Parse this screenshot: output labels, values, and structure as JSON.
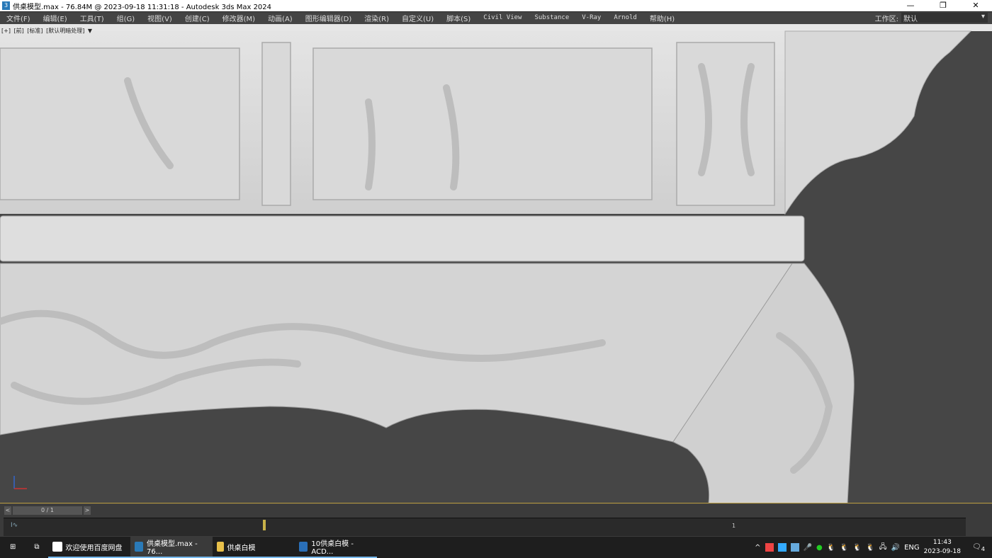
{
  "title_bar": {
    "app_icon": "3ds-max-icon",
    "title": "供桌模型.max - 76.84M @ 2023-09-18 11:31:18 - Autodesk 3ds Max 2024",
    "controls": [
      "minimize-icon",
      "restore-icon",
      "close-icon"
    ]
  },
  "menu": {
    "items": [
      "文件(F)",
      "编辑(E)",
      "工具(T)",
      "组(G)",
      "视图(V)",
      "创建(C)",
      "修改器(M)",
      "动画(A)",
      "图形编辑器(D)",
      "渲染(R)",
      "自定义(U)",
      "脚本(S)",
      "Civil View",
      "Substance",
      "V-Ray",
      "Arnold",
      "帮助(H)"
    ],
    "workspace_label": "工作区:",
    "workspace_value": "默认"
  },
  "viewport": {
    "labels": [
      "[+]",
      "[前]",
      "[标准]",
      "[默认明暗处理]"
    ],
    "filter_icon": "funnel-icon",
    "axis_icon": "axis-tripod-icon",
    "model_color": "#d6d6d6",
    "background": "#464646"
  },
  "timeline": {
    "frame_counter": "0 / 1",
    "prev": "<",
    "next": ">",
    "curve_icon": "curve-editor-icon",
    "end_frame": "1",
    "key_frame": "0"
  },
  "taskbar": {
    "items": [
      {
        "label": "欢迎使用百度网盘",
        "icon": "baidu-netdisk-icon",
        "color": "#2f8bff"
      },
      {
        "label": "供桌模型.max - 76...",
        "icon": "3ds-max-icon",
        "color": "#2a7ab8"
      },
      {
        "label": "供桌白模",
        "icon": "folder-icon",
        "color": "#e8c04a"
      },
      {
        "label": "10供桌白模 - ACD...",
        "icon": "acdsee-icon",
        "color": "#2a6fb8"
      }
    ],
    "tray": {
      "lang": "ENG",
      "time": "11:43",
      "date": "2023-09-18",
      "notifications": "4"
    }
  }
}
